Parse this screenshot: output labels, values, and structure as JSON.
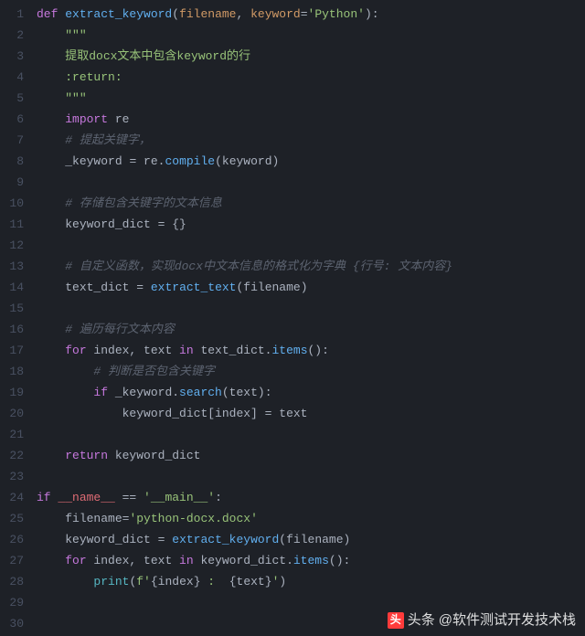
{
  "line_count": 30,
  "tokens": {
    "l1": [
      {
        "t": "def ",
        "c": "kw"
      },
      {
        "t": "extract_keyword",
        "c": "fn"
      },
      {
        "t": "(",
        "c": "punct"
      },
      {
        "t": "filename",
        "c": "param"
      },
      {
        "t": ", ",
        "c": "punct"
      },
      {
        "t": "keyword",
        "c": "param"
      },
      {
        "t": "=",
        "c": "op"
      },
      {
        "t": "'Python'",
        "c": "str"
      },
      {
        "t": "):",
        "c": "punct"
      }
    ],
    "l2": [
      {
        "t": "    ",
        "c": "plain"
      },
      {
        "t": "\"\"\"",
        "c": "doc"
      }
    ],
    "l3": [
      {
        "t": "    ",
        "c": "plain"
      },
      {
        "t": "提取docx文本中包含keyword的行",
        "c": "doc"
      }
    ],
    "l4": [
      {
        "t": "    ",
        "c": "plain"
      },
      {
        "t": ":return:",
        "c": "doc"
      }
    ],
    "l5": [
      {
        "t": "    ",
        "c": "plain"
      },
      {
        "t": "\"\"\"",
        "c": "doc"
      }
    ],
    "l6": [
      {
        "t": "    ",
        "c": "plain"
      },
      {
        "t": "import",
        "c": "kw"
      },
      {
        "t": " re",
        "c": "plain"
      }
    ],
    "l7": [
      {
        "t": "    ",
        "c": "plain"
      },
      {
        "t": "# 提起关键字，",
        "c": "com"
      }
    ],
    "l8": [
      {
        "t": "    ",
        "c": "plain"
      },
      {
        "t": "_keyword ",
        "c": "plain"
      },
      {
        "t": "=",
        "c": "op"
      },
      {
        "t": " re.",
        "c": "plain"
      },
      {
        "t": "compile",
        "c": "fn"
      },
      {
        "t": "(",
        "c": "punct"
      },
      {
        "t": "keyword",
        "c": "plain"
      },
      {
        "t": ")",
        "c": "punct"
      }
    ],
    "l9": [],
    "l10": [
      {
        "t": "    ",
        "c": "plain"
      },
      {
        "t": "# 存储包含关键字的文本信息",
        "c": "com"
      }
    ],
    "l11": [
      {
        "t": "    ",
        "c": "plain"
      },
      {
        "t": "keyword_dict ",
        "c": "plain"
      },
      {
        "t": "=",
        "c": "op"
      },
      {
        "t": " {}",
        "c": "plain"
      }
    ],
    "l12": [],
    "l13": [
      {
        "t": "    ",
        "c": "plain"
      },
      {
        "t": "# 自定义函数，实现docx中文本信息的格式化为字典 {行号: 文本内容}",
        "c": "com"
      }
    ],
    "l14": [
      {
        "t": "    ",
        "c": "plain"
      },
      {
        "t": "text_dict ",
        "c": "plain"
      },
      {
        "t": "=",
        "c": "op"
      },
      {
        "t": " ",
        "c": "plain"
      },
      {
        "t": "extract_text",
        "c": "fn"
      },
      {
        "t": "(",
        "c": "punct"
      },
      {
        "t": "filename",
        "c": "plain"
      },
      {
        "t": ")",
        "c": "punct"
      }
    ],
    "l15": [],
    "l16": [
      {
        "t": "    ",
        "c": "plain"
      },
      {
        "t": "# 遍历每行文本内容",
        "c": "com"
      }
    ],
    "l17": [
      {
        "t": "    ",
        "c": "plain"
      },
      {
        "t": "for",
        "c": "kw"
      },
      {
        "t": " index, text ",
        "c": "plain"
      },
      {
        "t": "in",
        "c": "kw"
      },
      {
        "t": " text_dict.",
        "c": "plain"
      },
      {
        "t": "items",
        "c": "fn"
      },
      {
        "t": "():",
        "c": "punct"
      }
    ],
    "l18": [
      {
        "t": "        ",
        "c": "plain"
      },
      {
        "t": "# 判断是否包含关键字",
        "c": "com"
      }
    ],
    "l19": [
      {
        "t": "        ",
        "c": "plain"
      },
      {
        "t": "if",
        "c": "kw"
      },
      {
        "t": " _keyword.",
        "c": "plain"
      },
      {
        "t": "search",
        "c": "fn"
      },
      {
        "t": "(",
        "c": "punct"
      },
      {
        "t": "text",
        "c": "plain"
      },
      {
        "t": "):",
        "c": "punct"
      }
    ],
    "l20": [
      {
        "t": "            ",
        "c": "plain"
      },
      {
        "t": "keyword_dict[index] ",
        "c": "plain"
      },
      {
        "t": "=",
        "c": "op"
      },
      {
        "t": " text",
        "c": "plain"
      }
    ],
    "l21": [],
    "l22": [
      {
        "t": "    ",
        "c": "plain"
      },
      {
        "t": "return",
        "c": "kw"
      },
      {
        "t": " keyword_dict",
        "c": "plain"
      }
    ],
    "l23": [],
    "l24": [
      {
        "t": "if",
        "c": "kw"
      },
      {
        "t": " __name__ ",
        "c": "var"
      },
      {
        "t": "==",
        "c": "op"
      },
      {
        "t": " ",
        "c": "plain"
      },
      {
        "t": "'__main__'",
        "c": "str"
      },
      {
        "t": ":",
        "c": "punct"
      }
    ],
    "l25": [
      {
        "t": "    ",
        "c": "plain"
      },
      {
        "t": "filename",
        "c": "plain"
      },
      {
        "t": "=",
        "c": "op"
      },
      {
        "t": "'python-docx.docx'",
        "c": "str"
      }
    ],
    "l26": [
      {
        "t": "    ",
        "c": "plain"
      },
      {
        "t": "keyword_dict ",
        "c": "plain"
      },
      {
        "t": "=",
        "c": "op"
      },
      {
        "t": " ",
        "c": "plain"
      },
      {
        "t": "extract_keyword",
        "c": "fn"
      },
      {
        "t": "(",
        "c": "punct"
      },
      {
        "t": "filename",
        "c": "plain"
      },
      {
        "t": ")",
        "c": "punct"
      }
    ],
    "l27": [
      {
        "t": "    ",
        "c": "plain"
      },
      {
        "t": "for",
        "c": "kw"
      },
      {
        "t": " index, text ",
        "c": "plain"
      },
      {
        "t": "in",
        "c": "kw"
      },
      {
        "t": " keyword_dict.",
        "c": "plain"
      },
      {
        "t": "items",
        "c": "fn"
      },
      {
        "t": "():",
        "c": "punct"
      }
    ],
    "l28": [
      {
        "t": "        ",
        "c": "plain"
      },
      {
        "t": "print",
        "c": "builtin"
      },
      {
        "t": "(",
        "c": "punct"
      },
      {
        "t": "f'",
        "c": "str"
      },
      {
        "t": "{",
        "c": "punct"
      },
      {
        "t": "index",
        "c": "plain"
      },
      {
        "t": "}",
        "c": "punct"
      },
      {
        "t": " :  ",
        "c": "str"
      },
      {
        "t": "{",
        "c": "punct"
      },
      {
        "t": "text",
        "c": "plain"
      },
      {
        "t": "}",
        "c": "punct"
      },
      {
        "t": "'",
        "c": "str"
      },
      {
        "t": ")",
        "c": "punct"
      }
    ],
    "l29": [],
    "l30": []
  },
  "watermark": {
    "icon": "头",
    "prefix": "头条",
    "author": "@软件测试开发技术栈"
  }
}
